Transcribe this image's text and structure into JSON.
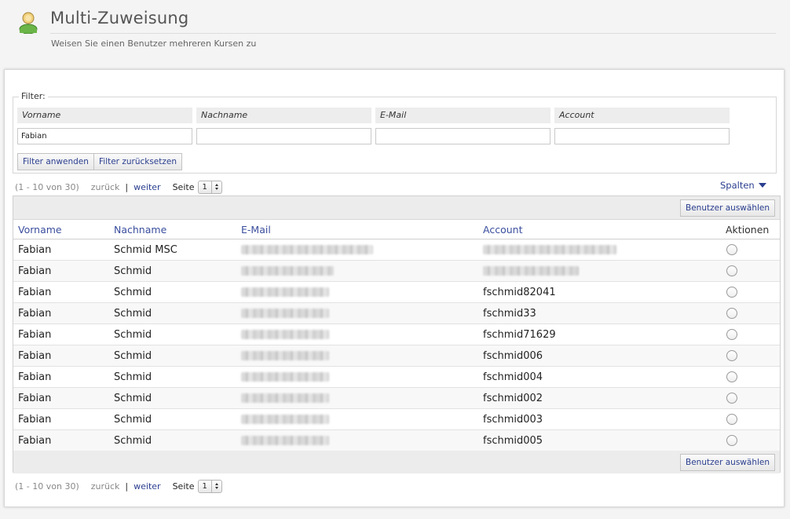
{
  "header": {
    "title": "Multi-Zuweisung",
    "subtitle": "Weisen Sie einen Benutzer mehreren Kursen zu",
    "icon": "user-icon"
  },
  "filter": {
    "legend": "Filter:",
    "fields": [
      {
        "label": "Vorname",
        "value": "Fabian"
      },
      {
        "label": "Nachname",
        "value": ""
      },
      {
        "label": "E-Mail",
        "value": ""
      },
      {
        "label": "Account",
        "value": ""
      }
    ],
    "apply_label": "Filter anwenden",
    "reset_label": "Filter zurücksetzen"
  },
  "pagination": {
    "range": "(1 - 10 von 30)",
    "prev": "zurück",
    "separator": "|",
    "next": "weiter",
    "page_label": "Seite",
    "page_value": "1"
  },
  "columns_toggle": "Spalten",
  "table": {
    "select_users_label": "Benutzer auswählen",
    "headers": [
      "Vorname",
      "Nachname",
      "E-Mail",
      "Account",
      "Aktionen"
    ],
    "rows": [
      {
        "vorname": "Fabian",
        "nachname": "Schmid MSC",
        "account": ""
      },
      {
        "vorname": "Fabian",
        "nachname": "Schmid",
        "account": ""
      },
      {
        "vorname": "Fabian",
        "nachname": "Schmid",
        "account": "fschmid82041"
      },
      {
        "vorname": "Fabian",
        "nachname": "Schmid",
        "account": "fschmid33"
      },
      {
        "vorname": "Fabian",
        "nachname": "Schmid",
        "account": "fschmid71629"
      },
      {
        "vorname": "Fabian",
        "nachname": "Schmid",
        "account": "fschmid006"
      },
      {
        "vorname": "Fabian",
        "nachname": "Schmid",
        "account": "fschmid004"
      },
      {
        "vorname": "Fabian",
        "nachname": "Schmid",
        "account": "fschmid002"
      },
      {
        "vorname": "Fabian",
        "nachname": "Schmid",
        "account": "fschmid003"
      },
      {
        "vorname": "Fabian",
        "nachname": "Schmid",
        "account": "fschmid005"
      }
    ]
  },
  "colors": {
    "link": "#2a3e8f",
    "header_link": "#3a4e9e"
  }
}
